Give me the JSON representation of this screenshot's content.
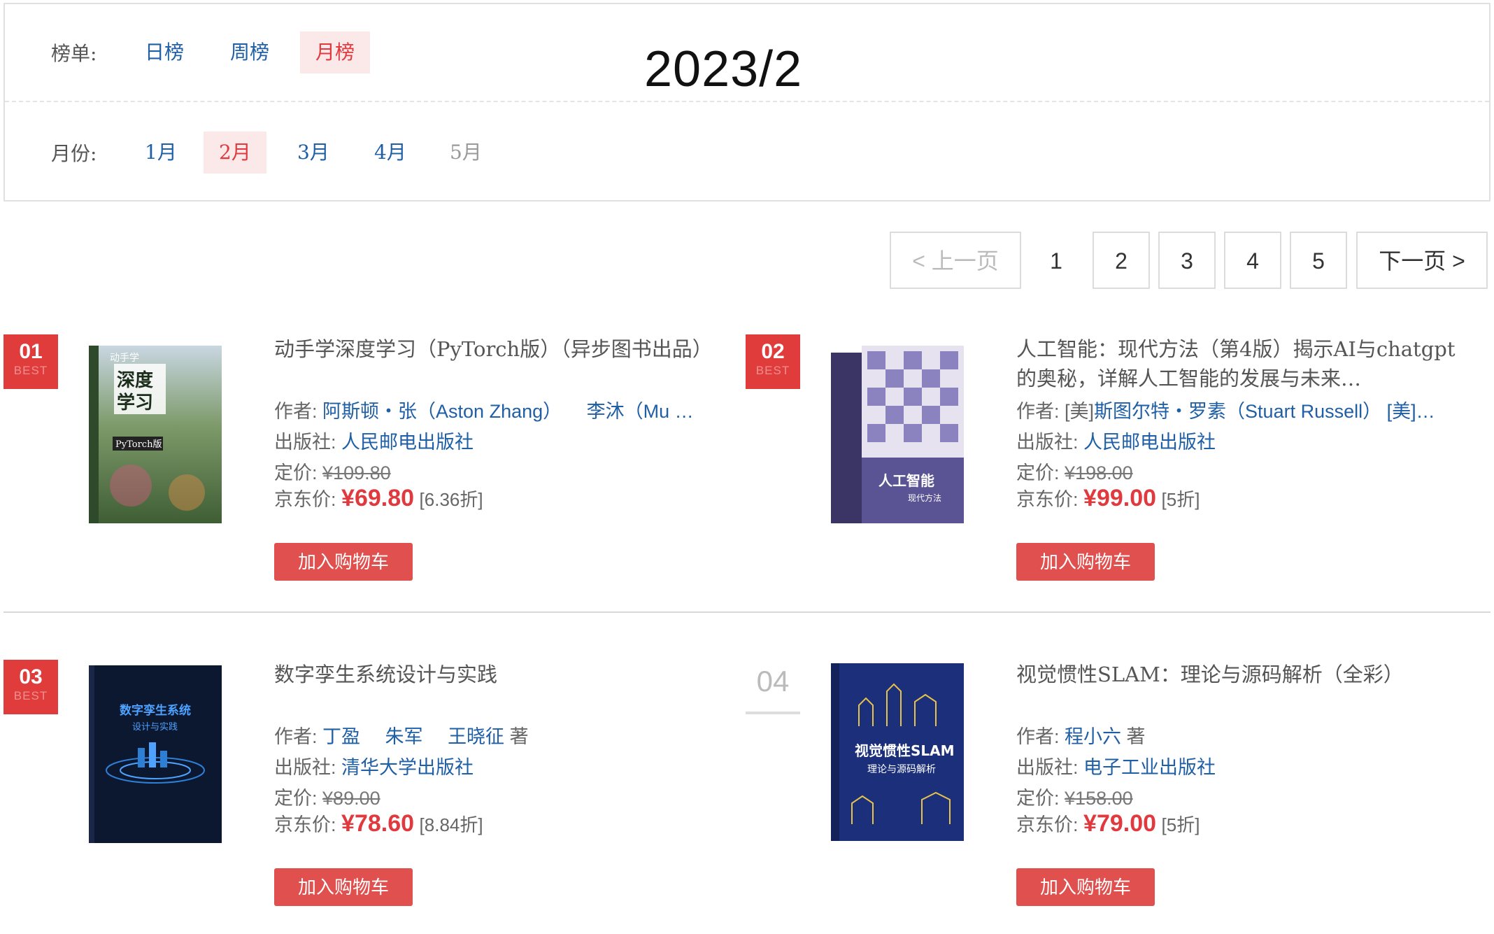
{
  "filter": {
    "ranking_label": "榜单:",
    "ranking_options": [
      "日榜",
      "周榜",
      "月榜"
    ],
    "ranking_active": "月榜",
    "period": "2023/2",
    "month_label": "月份:",
    "month_options": [
      "1月",
      "2月",
      "3月",
      "4月",
      "5月"
    ],
    "month_active": "2月",
    "month_disabled": "5月"
  },
  "pagination": {
    "prev": "< 上一页",
    "pages": [
      "1",
      "2",
      "3",
      "4",
      "5"
    ],
    "current": "1",
    "next": "下一页 >"
  },
  "labels": {
    "author": "作者:",
    "publisher": "出版社:",
    "list_price": "定价:",
    "jd_price": "京东价:",
    "add_to_cart": "加入购物车",
    "best": "BEST"
  },
  "books": [
    {
      "rank": "01",
      "best": true,
      "title": "动手学深度学习（PyTorch版）（异步图书出品）",
      "authors": [
        "阿斯顿・张（Aston Zhang）",
        "李沐（Mu …"
      ],
      "author_suffix": "",
      "publisher": "人民邮电出版社",
      "list_price": "¥109.80",
      "jd_price": "¥69.80",
      "discount": "[6.36折]",
      "cover": {
        "bg": "#6c8d5a",
        "accent": "#2c4a2a",
        "lines": [
          "动手学",
          "深度",
          "学习"
        ],
        "tag": "PyTorch版"
      }
    },
    {
      "rank": "02",
      "best": true,
      "title": "人工智能：现代方法（第4版）揭示AI与chatgpt的奥秘，详解人工智能的发展与未来…",
      "author_prefix": "[美]",
      "authors": [
        "斯图尔特・罗素（Stuart Russell）",
        "[美]…"
      ],
      "author_suffix": "",
      "publisher": "人民邮电出版社",
      "list_price": "¥198.00",
      "jd_price": "¥99.00",
      "discount": "[5折]",
      "cover": {
        "bg": "#6a63a0",
        "accent": "#3b3566",
        "lines": [
          "人工智能",
          "现代方法"
        ],
        "tag": ""
      }
    },
    {
      "rank": "03",
      "best": true,
      "title": "数字孪生系统设计与实践",
      "authors": [
        "丁盈",
        "朱军",
        "王晓征"
      ],
      "author_suffix": "著",
      "publisher": "清华大学出版社",
      "list_price": "¥89.00",
      "jd_price": "¥78.60",
      "discount": "[8.84折]",
      "cover": {
        "bg": "#0d1a33",
        "accent": "#2d7fd6",
        "lines": [
          "数字孪生系统",
          "设计与实践"
        ],
        "tag": ""
      }
    },
    {
      "rank": "04",
      "best": false,
      "title": "视觉惯性SLAM：理论与源码解析（全彩）",
      "authors": [
        "程小六"
      ],
      "author_suffix": "著",
      "publisher": "电子工业出版社",
      "list_price": "¥158.00",
      "jd_price": "¥79.00",
      "discount": "[5折]",
      "cover": {
        "bg": "#1c2f7a",
        "accent": "#e8c24a",
        "lines": [
          "视觉惯性SLAM",
          "理论与源码解析"
        ],
        "tag": ""
      }
    }
  ]
}
